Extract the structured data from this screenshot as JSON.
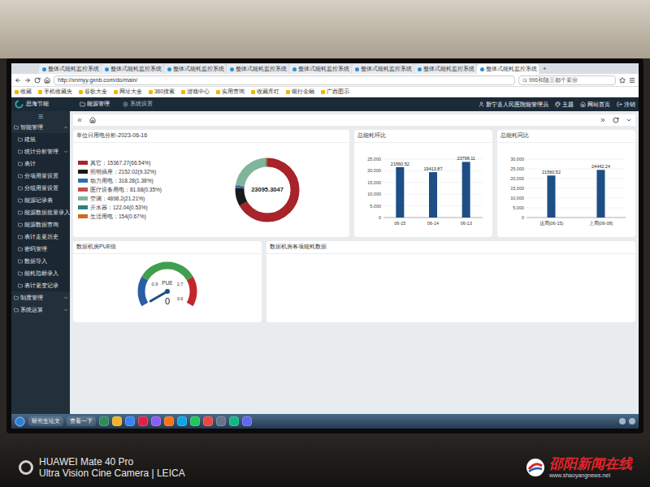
{
  "browser": {
    "tabs": [
      {
        "label": "整体式能耗监控系统",
        "selected": false
      },
      {
        "label": "整体式能耗监控系统",
        "selected": false
      },
      {
        "label": "整体式能耗监控系统",
        "selected": false
      },
      {
        "label": "整体式能耗监控系统",
        "selected": false
      },
      {
        "label": "整体式能耗监控系统",
        "selected": false
      },
      {
        "label": "整体式能耗监控系统",
        "selected": false
      },
      {
        "label": "整体式能耗监控系统",
        "selected": false
      },
      {
        "label": "整体式能耗监控系统",
        "selected": true
      }
    ],
    "new_tab": "+",
    "url": "http://xnmyy.gxnb.com/do/main/",
    "search": "996和随三都个要宗",
    "bookmarks": [
      "收藏",
      "手机收藏夹",
      "谷歌大全",
      "网址大全",
      "360搜索",
      "游戏中心",
      "实用查询",
      "收藏库红",
      "银行金融",
      "广西图示"
    ]
  },
  "app": {
    "logo": "思海节能",
    "nav": [
      {
        "label": "能源管理",
        "selected": true
      },
      {
        "label": "系统设置",
        "selected": false
      }
    ],
    "user": "新宁县人民医院能管理员",
    "actions": [
      "主题",
      "网站首页",
      "注销"
    ]
  },
  "sidebar": {
    "toggle": "☰",
    "items": [
      {
        "label": "智能管理",
        "kind": "group",
        "expanded": true
      },
      {
        "label": "建筑",
        "kind": "item"
      },
      {
        "label": "统计分析管理",
        "kind": "submenu",
        "expanded": false
      },
      {
        "label": "表计",
        "kind": "item"
      },
      {
        "label": "分项用量设置",
        "kind": "item"
      },
      {
        "label": "分组用量设置",
        "kind": "item"
      },
      {
        "label": "能源记录表",
        "kind": "item"
      },
      {
        "label": "能源数据批量录入",
        "kind": "item"
      },
      {
        "label": "能源数据查询",
        "kind": "item"
      },
      {
        "label": "表计走更历史",
        "kind": "item"
      },
      {
        "label": "密码管理",
        "kind": "item"
      },
      {
        "label": "数据导入",
        "kind": "item"
      },
      {
        "label": "能耗指标录入",
        "kind": "item"
      },
      {
        "label": "表计更变记录",
        "kind": "item"
      },
      {
        "label": "制度管理",
        "kind": "group",
        "expanded": false
      },
      {
        "label": "系统运算",
        "kind": "group",
        "expanded": false
      }
    ]
  },
  "donut": {
    "title": "单位日用电分析-2023-06-16",
    "total": "23095.3047",
    "items": [
      {
        "label": "其它：15367.27(66.54%)",
        "value": 15367.27,
        "color": "#a8232a"
      },
      {
        "label": "照明插座：2152.02(9.32%)",
        "value": 2152.02,
        "color": "#1a1a1a"
      },
      {
        "label": "动力用电：318.28(1.38%)",
        "value": 318.28,
        "color": "#2b6cb0"
      },
      {
        "label": "医疗设备用电：81.68(0.35%)",
        "value": 81.68,
        "color": "#c0504d"
      },
      {
        "label": "空调：4898.2(21.21%)",
        "value": 4898.2,
        "color": "#7fb59a"
      },
      {
        "label": "开水器：122.04(0.53%)",
        "value": 122.04,
        "color": "#2f7f7f"
      },
      {
        "label": "生活用电：154(0.67%)",
        "value": 154,
        "color": "#d2691e"
      }
    ]
  },
  "charts": [
    {
      "title": "总能耗环比",
      "ticks": [
        "0",
        "5,000",
        "10,000",
        "15,000",
        "20,000",
        "25,000"
      ],
      "categories": [
        "06-15",
        "06-14",
        "06-13"
      ],
      "series": [
        {
          "values": [
            21560.52,
            19413.87,
            23798.11
          ],
          "labels": [
            "21560.52",
            "19413.87",
            "23798.11"
          ]
        }
      ]
    },
    {
      "title": "总能耗同比",
      "ticks": [
        "0",
        "5,000",
        "10,000",
        "15,000",
        "20,000",
        "25,000",
        "30,000"
      ],
      "categories": [
        "这周(06-15)",
        "上周(06-08)"
      ],
      "series": [
        {
          "values": [
            21560.52,
            24442.24
          ],
          "labels": [
            "21560.52",
            "24442.24"
          ]
        }
      ]
    }
  ],
  "pue": {
    "title": "数据机房PUE值",
    "label": "PUE",
    "value": "0",
    "level": 0,
    "ticks": [
      "0.9",
      "2.7",
      "3.6"
    ],
    "bands": [
      {
        "level": 0.25,
        "color": "#2a5fa5"
      },
      {
        "level": 0.75,
        "color": "#3f9f4f"
      },
      {
        "level": 1,
        "color": "#c0282d"
      }
    ]
  },
  "room_panel": {
    "title": "数据机房各项能耗数据"
  },
  "taskbar": {
    "start": "研究生论文",
    "task": "查看一下"
  },
  "watermark": {
    "camera_model": "HUAWEI Mate 40 Pro",
    "camera_line": "Ultra Vision Cine Camera | LEICA",
    "site_name": "邵阳新闻在线",
    "site_url": "www.shaoyangnews.net"
  }
}
